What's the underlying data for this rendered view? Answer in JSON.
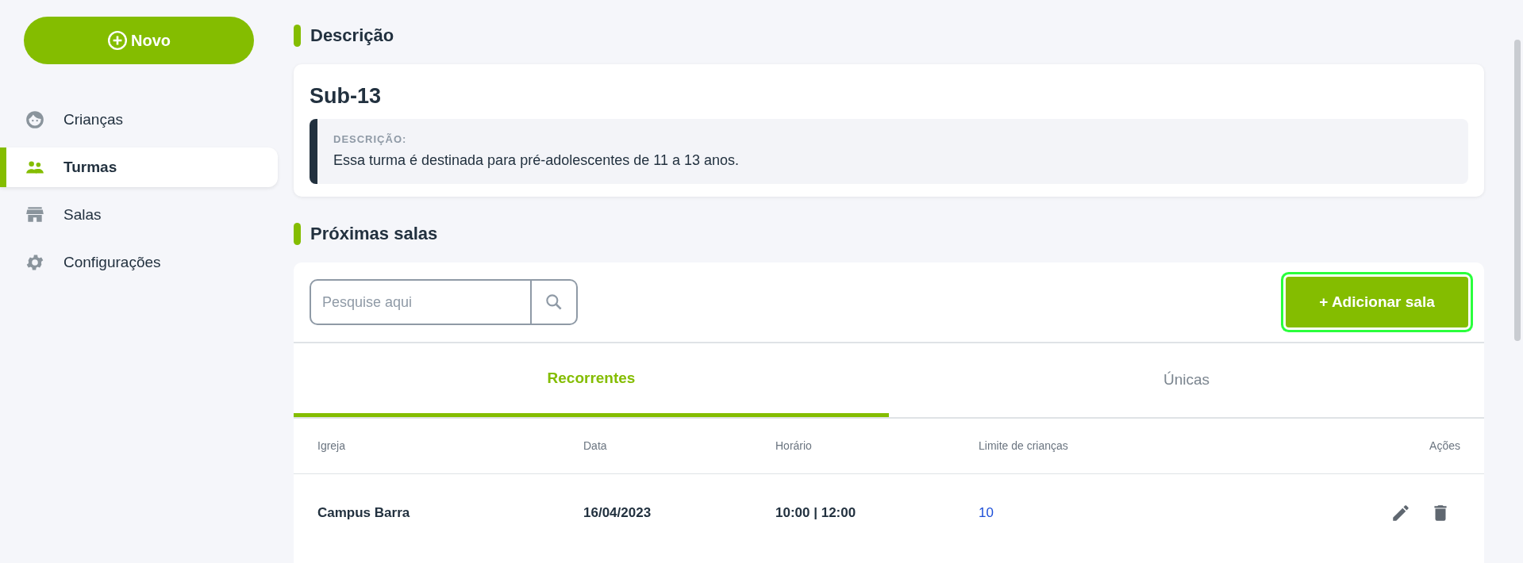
{
  "sidebar": {
    "new_button": "Novo",
    "items": [
      {
        "label": "Crianças",
        "kind": "children",
        "selected": false
      },
      {
        "label": "Turmas",
        "kind": "classes",
        "selected": true
      },
      {
        "label": "Salas",
        "kind": "rooms",
        "selected": false
      },
      {
        "label": "Configurações",
        "kind": "settings",
        "selected": false
      }
    ]
  },
  "description_section": {
    "heading": "Descrição",
    "title": "Sub-13",
    "label": "DESCRIÇÃO:",
    "text": "Essa turma é destinada para pré-adolescentes de 11 a 13 anos."
  },
  "rooms_section": {
    "heading": "Próximas salas",
    "search": {
      "placeholder": "Pesquise aqui"
    },
    "add_button": {
      "label": "+ Adicionar sala",
      "focused": true
    },
    "tabs": [
      {
        "label": "Recorrentes",
        "selected": true
      },
      {
        "label": "Únicas",
        "selected": false
      }
    ],
    "table": {
      "columns": [
        "Igreja",
        "Data",
        "Horário",
        "Limite de crianças",
        "Ações"
      ],
      "rows": [
        {
          "church": "Campus Barra",
          "date": "16/04/2023",
          "time": "10:00 | 12:00",
          "limit": "10"
        }
      ]
    }
  }
}
